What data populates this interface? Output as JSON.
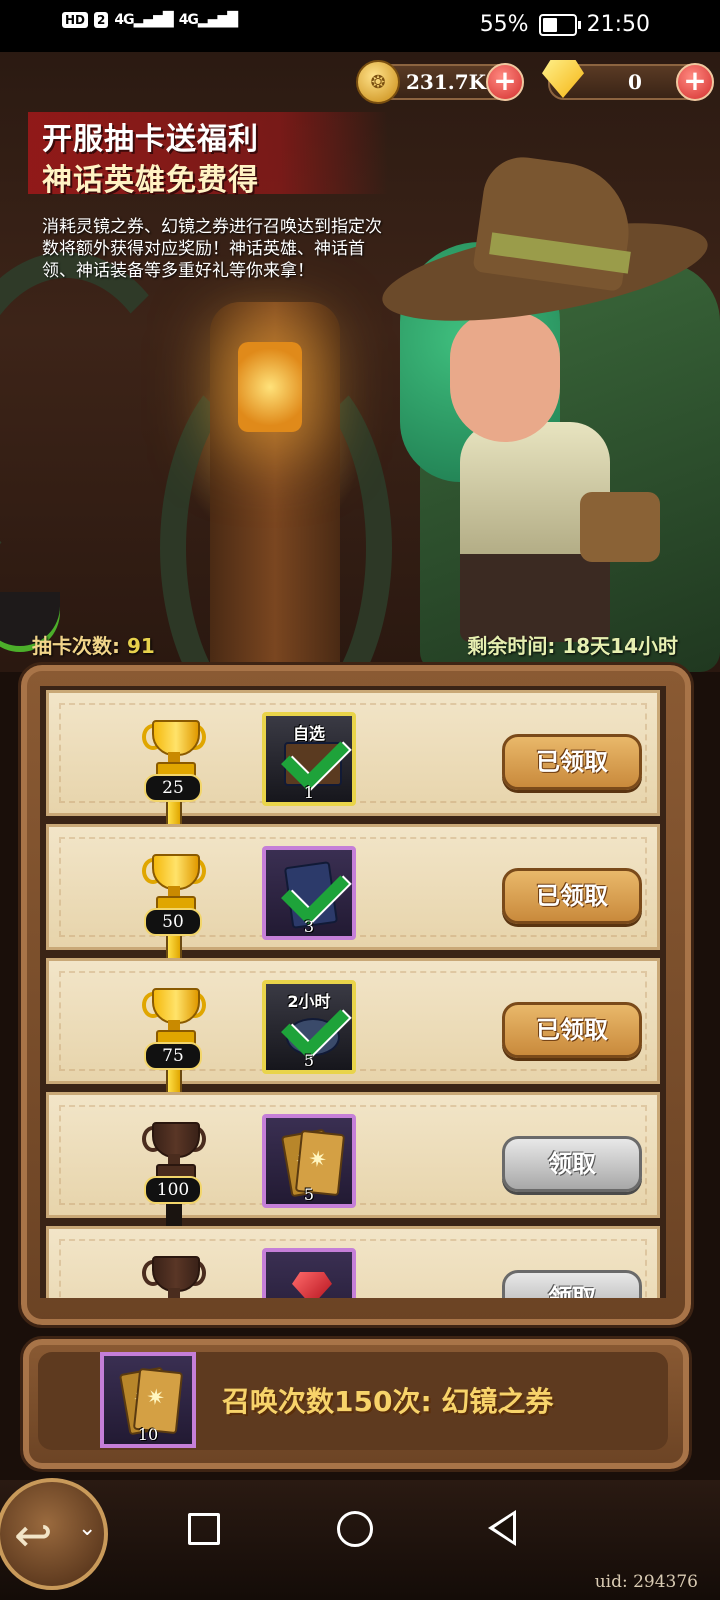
{
  "status_bar": {
    "network_chip": "HD",
    "sim_chip": "2",
    "signal_1": "4G",
    "signal_2": "4G",
    "battery": "55%",
    "battery_level": 0.55,
    "time": "21:50"
  },
  "currency": {
    "gold": "231.7K",
    "diamonds": "0",
    "gold_icon": "coin-icon",
    "diamond_icon": "diamond-icon",
    "add_icon": "plus-icon"
  },
  "promo": {
    "title_line1": "开服抽卡送福利",
    "title_line2": "神话英雄免费得",
    "description": "消耗灵镜之券、幻镜之券进行召唤达到指定次数将额外获得对应奖励！神话英雄、神话首领、神话装备等多重好礼等你来拿！"
  },
  "stats": {
    "draw_count_label": "抽卡次数:",
    "draw_count": "91",
    "remaining_label": "剩余时间:",
    "remaining": "18天14小时"
  },
  "rewards": [
    {
      "milestone": "25",
      "item_top": "自选",
      "qty": "1",
      "button": "已领取",
      "claimed": true,
      "frame": "gold",
      "art": "chest"
    },
    {
      "milestone": "50",
      "item_top": "",
      "qty": "3",
      "button": "已领取",
      "claimed": true,
      "frame": "purple",
      "art": "dark-cards"
    },
    {
      "milestone": "75",
      "item_top": "2小时",
      "qty": "5",
      "button": "已领取",
      "claimed": true,
      "frame": "gold",
      "art": "timer"
    },
    {
      "milestone": "100",
      "item_top": "",
      "qty": "5",
      "button": "领取",
      "claimed": false,
      "frame": "purple",
      "art": "gold-cards"
    },
    {
      "milestone": "",
      "item_top": "",
      "qty": "",
      "button": "领取",
      "claimed": false,
      "frame": "purple",
      "art": "ruby"
    }
  ],
  "bottom": {
    "item_qty": "10",
    "label": "召唤次数150次: 幻镜之券"
  },
  "footer": {
    "uid": "uid: 294376"
  },
  "colors": {
    "accent_gold": "#f7d36a",
    "claimed_button": "#c98a3c",
    "claim_button": "#a8a8a8",
    "check_green": "#1ea33a"
  }
}
